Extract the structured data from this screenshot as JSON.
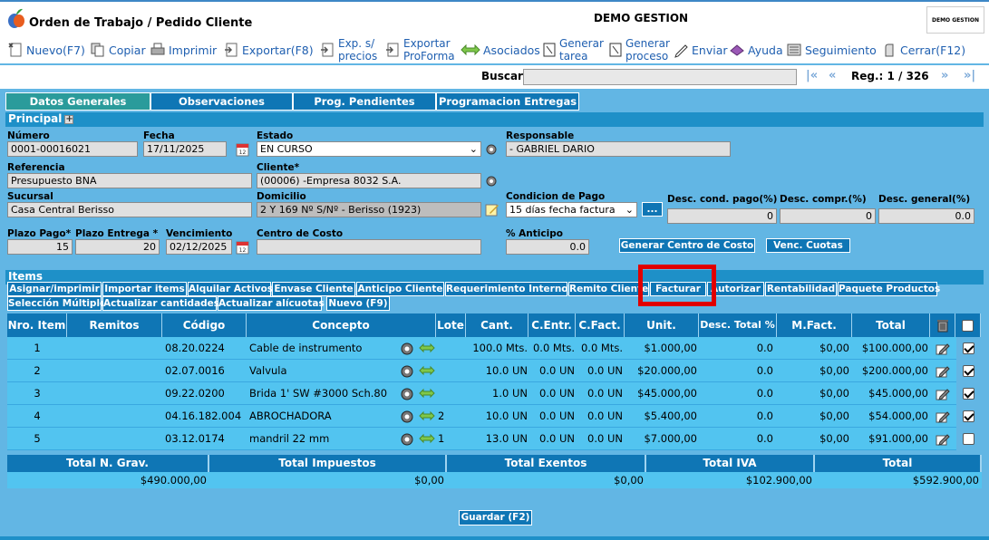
{
  "window": {
    "title": "Orden de Trabajo / Pedido Cliente",
    "company": "DEMO GESTION",
    "brand_box": "DEMO GESTION"
  },
  "toolbar": {
    "nuevo": "Nuevo(F7)",
    "copiar": "Copiar",
    "imprimir": "Imprimir",
    "exportar": "Exportar(F8)",
    "exp_precios_1": "Exp. s/",
    "exp_precios_2": "precios",
    "exportar_proforma_1": "Exportar",
    "exportar_proforma_2": "ProForma",
    "asociados": "Asociados",
    "generar_tarea_1": "Generar",
    "generar_tarea_2": "tarea",
    "generar_proceso_1": "Generar",
    "generar_proceso_2": "proceso",
    "enviar": "Enviar",
    "ayuda": "Ayuda",
    "seguimiento": "Seguimiento",
    "cerrar": "Cerrar(F12)"
  },
  "search": {
    "label": "Buscar",
    "value": "",
    "nav_first": "|«",
    "nav_prev": "«",
    "nav_next": "»",
    "nav_last": "»|",
    "reg": "Reg.: 1 / 326"
  },
  "tabs": [
    {
      "label": "Datos Generales"
    },
    {
      "label": "Observaciones"
    },
    {
      "label": "Prog. Pendientes"
    },
    {
      "label": "Programacion Entregas"
    }
  ],
  "principal": {
    "header": "Principal",
    "numero_label": "Número",
    "numero": "0001-00016021",
    "fecha_label": "Fecha",
    "fecha": "17/11/2025",
    "estado_label": "Estado",
    "estado": "EN CURSO",
    "responsable_label": "Responsable",
    "responsable": "- GABRIEL DARIO",
    "referencia_label": "Referencia",
    "referencia": "Presupuesto BNA",
    "cliente_label": "Cliente*",
    "cliente": "(00006) -Empresa 8032 S.A.",
    "sucursal_label": "Sucursal",
    "sucursal": "Casa Central Berisso",
    "domicilio_label": "Domicilio",
    "domicilio": "2 Y 169 Nº S/Nº - Berisso (1923)",
    "condicion_label": "Condicion de Pago",
    "condicion": "15 días fecha factura",
    "condicion_btn": "...",
    "desc_cond_label": "Desc. cond. pago(%)",
    "desc_cond": "0",
    "desc_compr_label": "Desc. compr.(%)",
    "desc_compr": "0",
    "desc_general_label": "Desc. general(%)",
    "desc_general": "0.0",
    "plazo_pago_label": "Plazo Pago*",
    "plazo_pago": "15",
    "plazo_entrega_label": "Plazo Entrega *",
    "plazo_entrega": "20",
    "vencimiento_label": "Vencimiento",
    "vencimiento": "02/12/2025",
    "centro_costo_label": "Centro de Costo",
    "centro_costo": "",
    "anticipo_label": "% Anticipo",
    "anticipo": "0.0",
    "generar_cc_btn": "Generar Centro de Costo",
    "venc_cuotas_btn": "Venc. Cuotas"
  },
  "items": {
    "header": "Items",
    "buttons_row1": [
      "Asignar/imprimir",
      "Importar items",
      "Alquilar Activos",
      "Envase Cliente",
      "Anticipo Cliente",
      "Requerimiento Interno",
      "Remito Cliente",
      "Facturar",
      "Autorizar",
      "Rentabilidad",
      "Paquete Productos"
    ],
    "buttons_row2": [
      "Selección Múltiple",
      "Actualizar cantidades",
      "Actualizar alícuotas",
      "Nuevo (F9)"
    ],
    "columns": [
      "Nro. Item",
      "Remitos",
      "Código",
      "Concepto",
      "Lote",
      "Cant.",
      "C.Entr.",
      "C.Fact.",
      "Unit.",
      "Desc. Total %",
      "M.Fact.",
      "Total"
    ],
    "rows": [
      {
        "nro": "1",
        "remitos": "",
        "codigo": "08.20.0224",
        "concepto": "Cable de instrumento",
        "extra": "",
        "lote": "",
        "cant": "100.0 Mts.",
        "centr": "0.0 Mts.",
        "cfact": "0.0 Mts.",
        "unit": "$1.000,00",
        "desc": "0.0",
        "mfact": "$0,00",
        "total": "$100.000,00",
        "checked": true
      },
      {
        "nro": "2",
        "remitos": "",
        "codigo": "02.07.0016",
        "concepto": "Valvula",
        "extra": "",
        "lote": "",
        "cant": "10.0 UN",
        "centr": "0.0 UN",
        "cfact": "0.0 UN",
        "unit": "$20.000,00",
        "desc": "0.0",
        "mfact": "$0,00",
        "total": "$200.000,00",
        "checked": true
      },
      {
        "nro": "3",
        "remitos": "",
        "codigo": "09.22.0200",
        "concepto": "Brida 1' SW #3000 Sch.80",
        "extra": "",
        "lote": "",
        "cant": "1.0 UN",
        "centr": "0.0 UN",
        "cfact": "0.0 UN",
        "unit": "$45.000,00",
        "desc": "0.0",
        "mfact": "$0,00",
        "total": "$45.000,00",
        "checked": true
      },
      {
        "nro": "4",
        "remitos": "",
        "codigo": "04.16.182.004",
        "concepto": "ABROCHADORA",
        "extra": "2",
        "lote": "",
        "cant": "10.0 UN",
        "centr": "0.0 UN",
        "cfact": "0.0 UN",
        "unit": "$5.400,00",
        "desc": "0.0",
        "mfact": "$0,00",
        "total": "$54.000,00",
        "checked": true
      },
      {
        "nro": "5",
        "remitos": "",
        "codigo": "03.12.0174",
        "concepto": "mandril 22 mm",
        "extra": "1",
        "lote": "",
        "cant": "13.0 UN",
        "centr": "0.0 UN",
        "cfact": "0.0 UN",
        "unit": "$7.000,00",
        "desc": "0.0",
        "mfact": "$0,00",
        "total": "$91.000,00",
        "checked": false
      }
    ]
  },
  "totals": {
    "headers": [
      "Total N. Grav.",
      "Total Impuestos",
      "Total Exentos",
      "Total IVA",
      "Total"
    ],
    "values": [
      "$490.000,00",
      "$0,00",
      "$0,00",
      "$102.900,00",
      "$592.900,00"
    ]
  },
  "guardar": "Guardar (F2)",
  "colors": {
    "highlight": "#e00000",
    "header_blue": "#0f76b5",
    "row_blue": "#52c4f0",
    "page_bg": "#62b6e4"
  }
}
